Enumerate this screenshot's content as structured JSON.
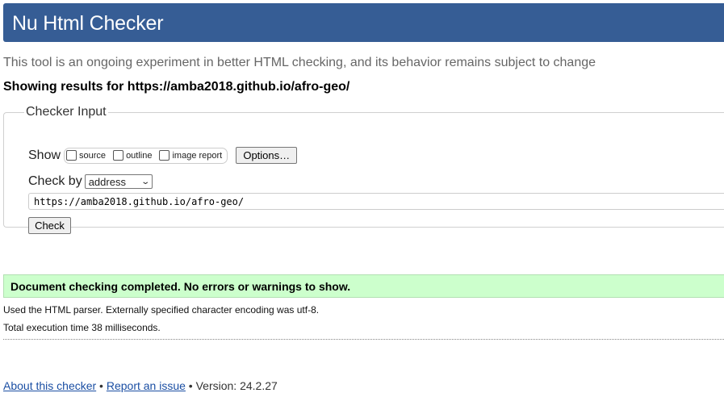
{
  "header": {
    "title": "Nu Html Checker",
    "bg_color": "#365d95"
  },
  "tagline": "This tool is an ongoing experiment in better HTML checking, and its behavior remains subject to change",
  "results_for": "Showing results for https://amba2018.github.io/afro-geo/",
  "checker": {
    "legend": "Checker Input",
    "show_label": "Show",
    "show_options": [
      {
        "label": "source",
        "checked": false
      },
      {
        "label": "outline",
        "checked": false
      },
      {
        "label": "image report",
        "checked": false
      }
    ],
    "options_button": "Options…",
    "check_by_label": "Check by",
    "check_by_selected": "address",
    "url_value": "https://amba2018.github.io/afro-geo/",
    "check_button": "Check"
  },
  "result": {
    "message": "Document checking completed. No errors or warnings to show.",
    "bg_color": "#ccffcc",
    "parser_info": "Used the HTML parser. Externally specified character encoding was utf-8.",
    "execution_time": "Total execution time 38 milliseconds."
  },
  "footer": {
    "about_link": "About this checker",
    "separator1": " • ",
    "report_link": "Report an issue",
    "version_text": " • Version: 24.2.27"
  }
}
